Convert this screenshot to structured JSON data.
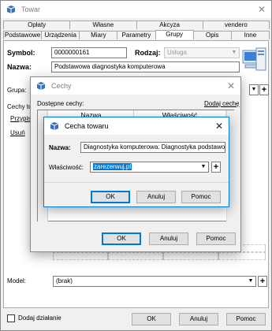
{
  "main_window": {
    "title": "Towar",
    "tabs_top": [
      "Opłaty",
      "Własne",
      "Akcyza",
      "vendero"
    ],
    "tabs_bottom": [
      "Podstawowe",
      "Urządzenia",
      "Miary",
      "Parametry",
      "Grupy",
      "Opis",
      "Inne"
    ],
    "selected_tab": "Grupy",
    "symbol_label": "Symbol:",
    "symbol_value": "0000000161",
    "rodzaj_label": "Rodzaj:",
    "rodzaj_value": "Usługa",
    "nazwa_label": "Nazwa:",
    "nazwa_value": "Podstawowa diagnostyka komputerowa",
    "grupa_label": "Grupa:",
    "cechy_label": "Cechy to",
    "przypisz_link": "Przypis",
    "usun_link": "Usuń",
    "model_label": "Model:",
    "model_value": "(brak)",
    "dodaj_dzialanie_label": "Dodaj działanie",
    "ok_label": "OK",
    "anuluj_label": "Anuluj",
    "pomoc_label": "Pomoc"
  },
  "cechy_dialog": {
    "title": "Cechy",
    "dostepne_label": "Dostępne cechy:",
    "dodaj_cechy_link": "Dodaj cechę",
    "col_nazwa": "Nazwa",
    "col_wlasciwosc": "Właściwość",
    "ok_label": "OK",
    "anuluj_label": "Anuluj",
    "pomoc_label": "Pomoc"
  },
  "cecha_dialog": {
    "title": "Cecha towaru",
    "nazwa_label": "Nazwa:",
    "nazwa_value": "Diagnostyka komputerowa: Diagnostyka podstawo",
    "wlasciwosc_label": "Właściwość:",
    "wlasciwosc_value": "zarezerwuj.pl",
    "ok_label": "OK",
    "anuluj_label": "Anuluj",
    "pomoc_label": "Pomoc"
  },
  "colors": {
    "accent": "#0078d7",
    "selection": "#0078d7"
  }
}
